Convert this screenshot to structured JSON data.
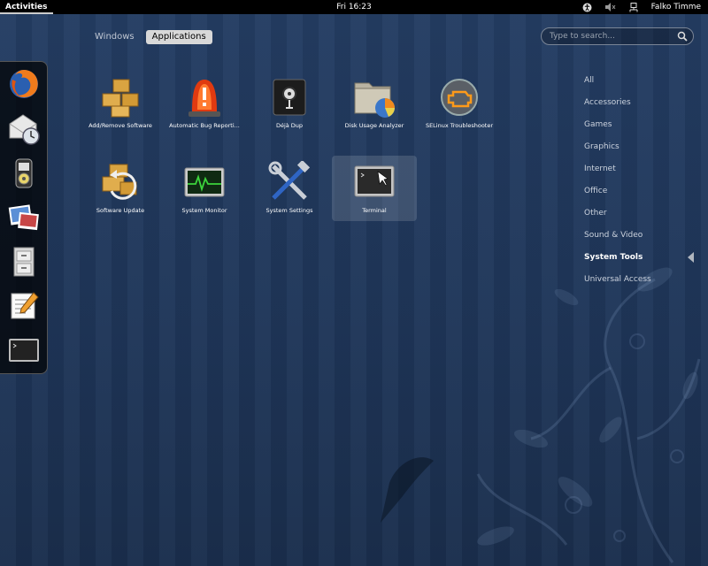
{
  "top_bar": {
    "activities_label": "Activities",
    "clock": "Fri 16:23",
    "user_name": "Falko Timme",
    "tray_icons": [
      "accessibility-icon",
      "volume-muted-icon",
      "network-wired-icon"
    ]
  },
  "view_switcher": {
    "tabs": [
      {
        "label": "Windows",
        "active": false
      },
      {
        "label": "Applications",
        "active": true
      }
    ]
  },
  "search": {
    "placeholder": "Type to search...",
    "value": ""
  },
  "dash": {
    "items": [
      "firefox-icon",
      "evolution-icon",
      "rhythmbox-icon",
      "shotwell-icon",
      "file-manager-icon",
      "text-editor-icon",
      "terminal-icon"
    ]
  },
  "apps": [
    {
      "label": "Add/Remove Software",
      "icon": "package-icon"
    },
    {
      "label": "Automatic Bug Reporti...",
      "icon": "alarm-light-icon"
    },
    {
      "label": "Déjà Dup",
      "icon": "safe-icon"
    },
    {
      "label": "Disk Usage Analyzer",
      "icon": "disk-usage-icon"
    },
    {
      "label": "SELinux Troubleshooter",
      "icon": "selinux-icon"
    },
    {
      "label": "Software Update",
      "icon": "software-update-icon"
    },
    {
      "label": "System Monitor",
      "icon": "system-monitor-icon"
    },
    {
      "label": "System Settings",
      "icon": "settings-tools-icon"
    },
    {
      "label": "Terminal",
      "icon": "terminal-icon",
      "selected": true
    }
  ],
  "categories": [
    {
      "label": "All"
    },
    {
      "label": "Accessories"
    },
    {
      "label": "Games"
    },
    {
      "label": "Graphics"
    },
    {
      "label": "Internet"
    },
    {
      "label": "Office"
    },
    {
      "label": "Other"
    },
    {
      "label": "Sound & Video"
    },
    {
      "label": "System Tools",
      "active": true
    },
    {
      "label": "Universal Access"
    }
  ],
  "colors": {
    "background": "#1f3558",
    "top_bar": "#000000",
    "active_tab": "#d8d8d8",
    "terminal_green": "#3cd43c"
  }
}
